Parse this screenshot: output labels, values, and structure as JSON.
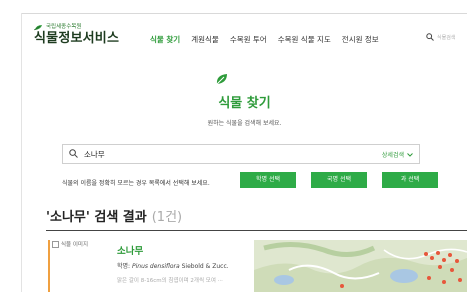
{
  "header": {
    "org_name": "국립세종수목원",
    "site_name": "식물정보서비스",
    "nav": [
      "식물 찾기",
      "계원식물",
      "수목원 투어",
      "수목원 식물 지도",
      "전시원 정보"
    ],
    "search_placeholder": "식물검색"
  },
  "main": {
    "title": "식물 찾기",
    "subtitle": "원하는 식물을 검색해 보세요.",
    "search_value": "소나무",
    "advanced_search": "상세검색",
    "hint": "식물의 이름을 정확히 모르는 경우 목록에서 선택해 보세요.",
    "buttons": [
      "학명 선택",
      "국명 선택",
      "과 선택"
    ]
  },
  "results": {
    "title": "'소나무' 검색 결과",
    "count": "(1건)",
    "items": [
      {
        "image_alt": "식물 이미지",
        "name": "소나무",
        "sci_prefix": "학명: ",
        "sci_name": "Pinus densiflora",
        "sci_author": " Siebold & Zucc.",
        "desc": "맑은 갈이 8-16cm의 침엽이며 2개씩 모여 ···"
      }
    ]
  },
  "colors": {
    "accent": "#2e9b3a",
    "button": "#2eab47",
    "result_marker": "#f0a040"
  }
}
